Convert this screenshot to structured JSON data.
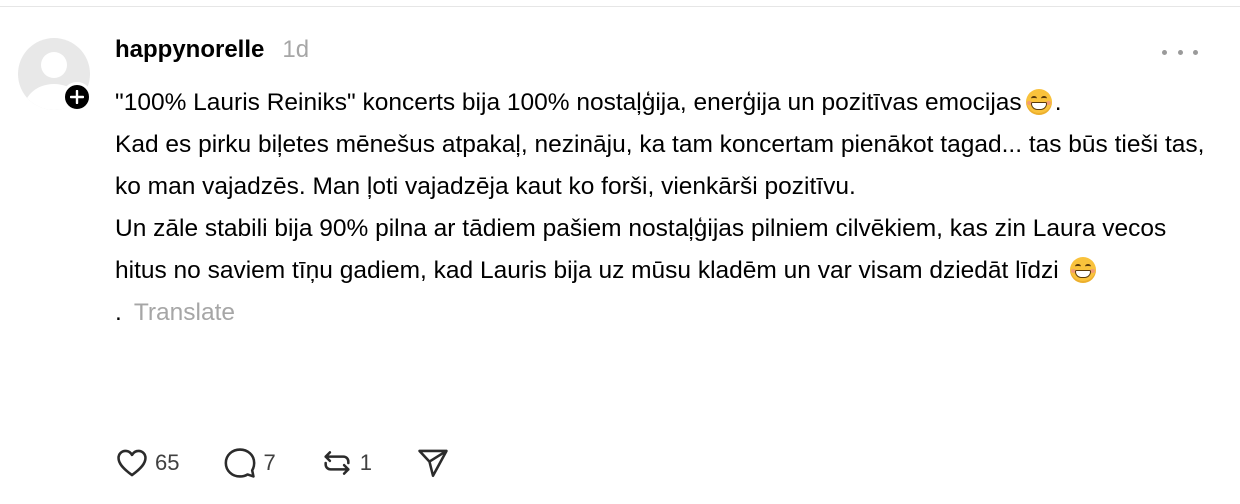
{
  "post": {
    "username": "happynorelle",
    "timestamp": "1d",
    "paragraphs": [
      {
        "text": "\"100% Lauris Reiniks\" koncerts bija 100% nostaļģija, enerģija un pozitīvas emocijas",
        "emoji": "grinning-face-emoji",
        "tail": "."
      },
      {
        "text": "Kad es pirku biļetes mēnešus atpakaļ, nezināju, ka tam koncertam pienākot tagad... tas būs tieši tas, ko man vajadzēs. Man ļoti vajadzēja kaut ko forši, vienkārši pozitīvu."
      },
      {
        "text": "Un zāle stabili bija 90% pilna ar tādiem pašiem nostaļģijas pilniem cilvēkiem, kas zin Laura vecos hitus no saviem tīņu gadiem, kad Lauris bija uz mūsu kladēm un var visam dziedāt līdzi",
        "emoji": "grinning-face-emoji",
        "tail": "."
      }
    ],
    "translate_label": "Translate"
  },
  "actions": {
    "likes": "65",
    "replies": "7",
    "reposts": "1"
  },
  "icons": {
    "follow": "plus-icon",
    "more": "more-dots-icon",
    "like": "heart-icon",
    "reply": "comment-icon",
    "repost": "repost-icon",
    "share": "send-icon"
  },
  "colors": {
    "text": "#000000",
    "muted": "#a6a6a6",
    "avatar_bg": "#e8e8e8"
  }
}
